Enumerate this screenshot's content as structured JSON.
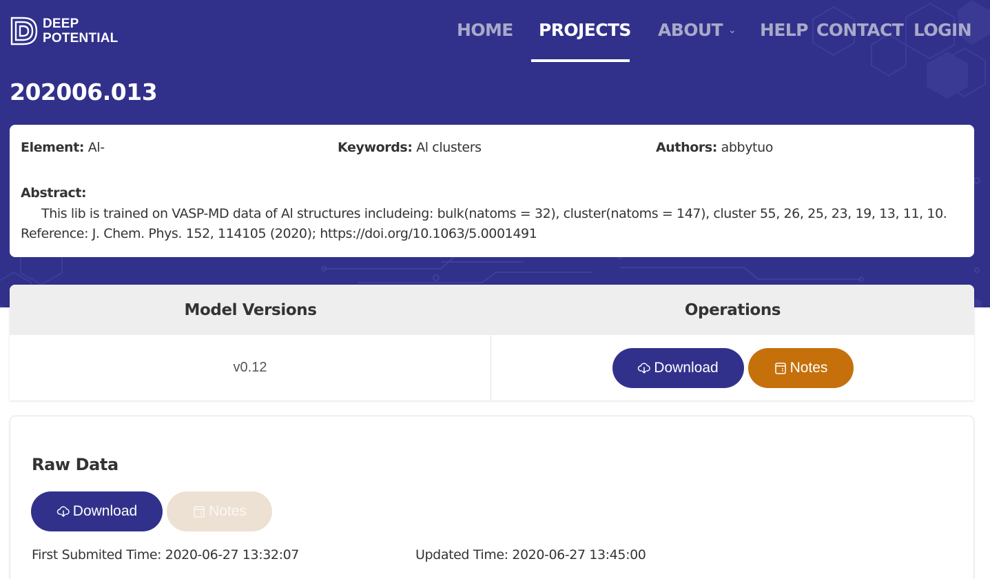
{
  "brand": {
    "line1": "DEEP",
    "line2": "POTENTIAL"
  },
  "nav": {
    "home": "HOME",
    "projects": "PROJECTS",
    "about": "ABOUT",
    "help": "HELP",
    "contact": "CONTACT",
    "login": "LOGIN"
  },
  "project": {
    "title": "202006.013",
    "element_label": "Element:",
    "element_value": "Al-",
    "keywords_label": "Keywords:",
    "keywords_value": "Al clusters",
    "authors_label": "Authors:",
    "authors_value": "abbytuo",
    "abstract_label": "Abstract:",
    "abstract_text": "This lib is trained on VASP-MD data of Al structures includeing: bulk(natoms = 32), cluster(natoms = 147), cluster 55, 26, 25, 23, 19, 13, 11, 10. Reference: J. Chem. Phys. 152, 114105 (2020); https://doi.org/10.1063/5.0001491"
  },
  "models": {
    "col_versions": "Model Versions",
    "col_operations": "Operations",
    "rows": [
      {
        "version": "v0.12",
        "download_label": "Download",
        "notes_label": "Notes"
      }
    ]
  },
  "raw_data": {
    "title": "Raw Data",
    "download_label": "Download",
    "notes_label": "Notes",
    "first_submitted": "First Submited Time: 2020-06-27 13:32:07",
    "updated": "Updated Time: 2020-06-27 13:45:00"
  },
  "colors": {
    "brand": "#31318c",
    "notes": "#c5700a",
    "notes_disabled": "#ede1d4"
  }
}
